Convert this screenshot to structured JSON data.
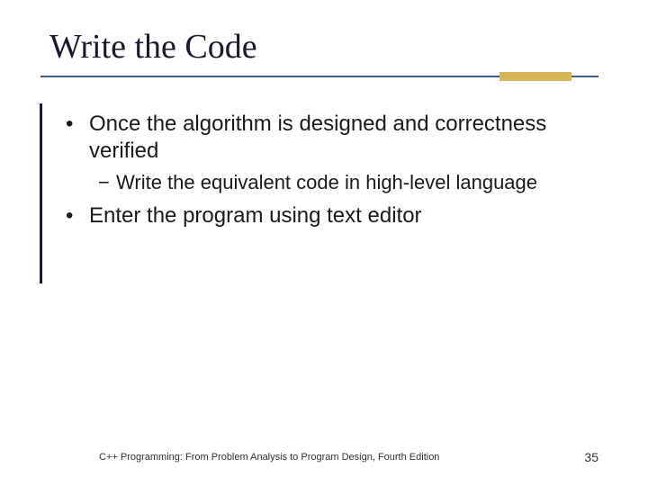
{
  "title": "Write the Code",
  "bullets": [
    {
      "level": 1,
      "text": "Once the algorithm is designed and correctness verified"
    },
    {
      "level": 2,
      "text": "Write the equivalent code in high-level language"
    },
    {
      "level": 1,
      "text": "Enter the program using text editor"
    }
  ],
  "footer": {
    "source": "C++ Programming: From Problem Analysis to Program Design, Fourth Edition",
    "page": "35"
  },
  "colors": {
    "accentBlue": "#3b5c8a",
    "accentGold": "#d6b656",
    "text": "#1a1a1a"
  }
}
